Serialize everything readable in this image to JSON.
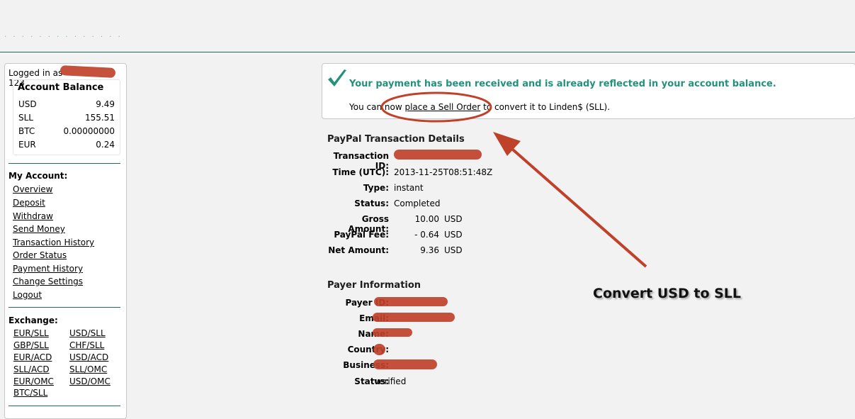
{
  "header": {
    "site_title": "· · · ·  · · · · · · · · · ·"
  },
  "sidebar": {
    "logged_in_label": "Logged in as",
    "logged_in_suffix": "123",
    "balance_title": "Account Balance",
    "balances": [
      {
        "currency": "USD",
        "amount": "9.49"
      },
      {
        "currency": "SLL",
        "amount": "155.51"
      },
      {
        "currency": "BTC",
        "amount": "0.00000000"
      },
      {
        "currency": "EUR",
        "amount": "0.24"
      }
    ],
    "my_account_title": "My Account:",
    "my_account_links": [
      "Overview",
      "Deposit",
      "Withdraw",
      "Send Money",
      "Transaction History",
      "Order Status",
      "Payment History",
      "Change Settings",
      "Logout"
    ],
    "exchange_title": "Exchange:",
    "exchange_links": [
      "EUR/SLL",
      "USD/SLL",
      "GBP/SLL",
      "CHF/SLL",
      "EUR/ACD",
      "USD/ACD",
      "SLL/ACD",
      "SLL/OMC",
      "EUR/OMC",
      "USD/OMC",
      "BTC/SLL"
    ]
  },
  "notice": {
    "headline": "Your payment has been received and is already reflected in your account balance.",
    "prefix": "You can now ",
    "link": "place a Sell Order",
    "suffix": " to convert it to Linden$ (SLL)."
  },
  "paypal": {
    "title": "PayPal Transaction Details",
    "rows": [
      {
        "label": "Transaction ID:",
        "value": ""
      },
      {
        "label": "Time (UTC):",
        "value": "2013-11-25T08:51:48Z"
      },
      {
        "label": "Type:",
        "value": "instant"
      },
      {
        "label": "Status:",
        "value": "Completed"
      },
      {
        "label": "Gross Amount:",
        "value": "10.00",
        "unit": "USD"
      },
      {
        "label": "PayPal Fee:",
        "value": "- 0.64",
        "unit": "USD"
      },
      {
        "label": "Net Amount:",
        "value": "9.36",
        "unit": "USD"
      }
    ]
  },
  "payer": {
    "title": "Payer Information",
    "rows": [
      {
        "label": "Payer ID:",
        "value": ""
      },
      {
        "label": "Email:",
        "value": ""
      },
      {
        "label": "Name:",
        "value": ""
      },
      {
        "label": "Country:",
        "value": ""
      },
      {
        "label": "Business:",
        "value": ""
      },
      {
        "label": "Status:",
        "value": "verified"
      }
    ]
  },
  "annotation": {
    "callout": "Convert USD to SLL",
    "color": "#c0412a"
  },
  "colors": {
    "accent_green": "#23917c",
    "rule": "#1f6b5c"
  }
}
